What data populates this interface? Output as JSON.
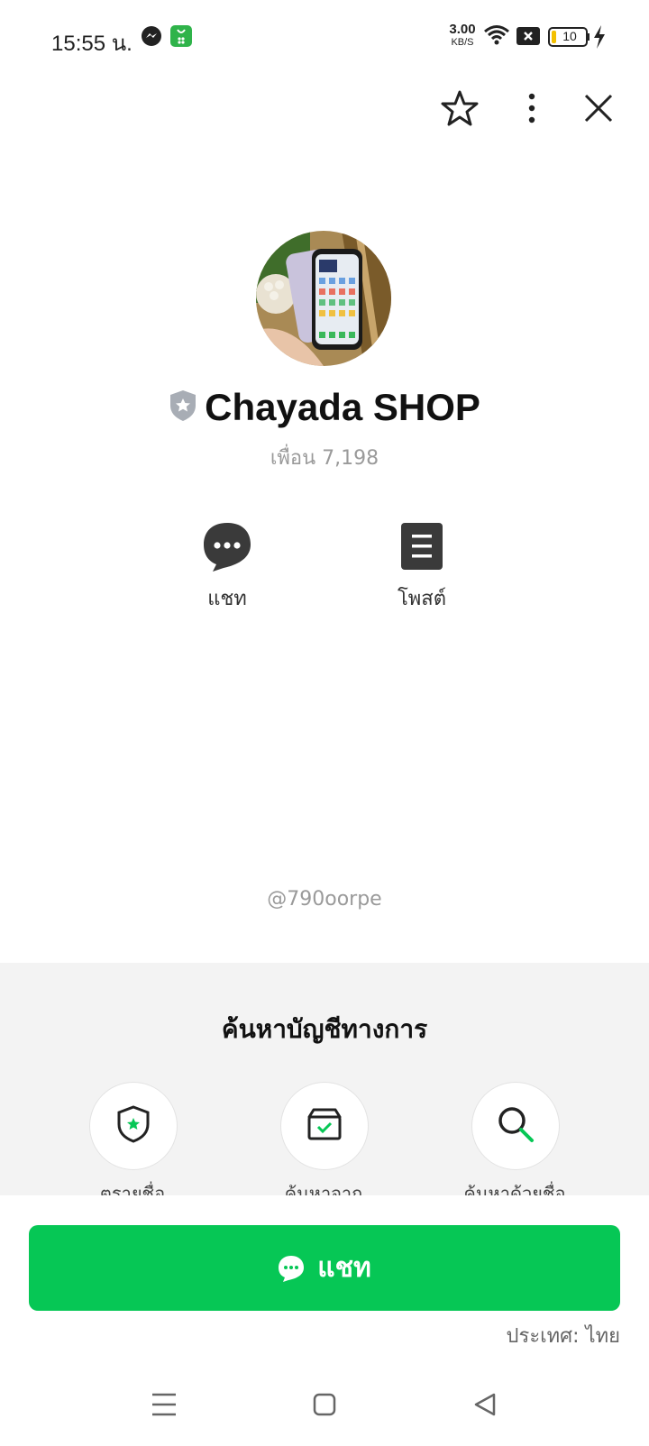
{
  "status_bar": {
    "time": "15:55 น.",
    "net_speed_value": "3.00",
    "net_speed_unit": "KB/S",
    "battery": "10",
    "icons": [
      "messenger-icon",
      "app-store-icon",
      "wifi-icon",
      "no-sim-icon",
      "battery-icon",
      "charging-icon"
    ]
  },
  "header": {
    "icons": [
      "star-icon",
      "more-vertical-icon",
      "close-icon"
    ]
  },
  "profile": {
    "name": "Chayada SHOP",
    "friends": "เพื่อน 7,198",
    "handle": "@790oorpe"
  },
  "actions": [
    {
      "label": "แชท",
      "icon": "chat-bubble-icon"
    },
    {
      "label": "โพสต์",
      "icon": "post-icon"
    }
  ],
  "official_search": {
    "title": "ค้นหาบัญชีทางการ",
    "items": [
      {
        "label": "ตรายชื่อ",
        "icon": "shield-star-icon"
      },
      {
        "label": "ค้นหาจาก",
        "icon": "box-check-icon"
      },
      {
        "label": "ค้นหาด้วยชื่อ",
        "icon": "search-icon"
      }
    ]
  },
  "footer": {
    "chat_button": "แชท",
    "country": "ประเทศ: ไทย"
  },
  "nav_bar": {
    "icons": [
      "menu-icon",
      "home-square-icon",
      "back-triangle-icon"
    ]
  },
  "colors": {
    "accent": "#06c755",
    "panel_bg": "#f3f3f3",
    "muted_text": "#9a9a9a"
  }
}
